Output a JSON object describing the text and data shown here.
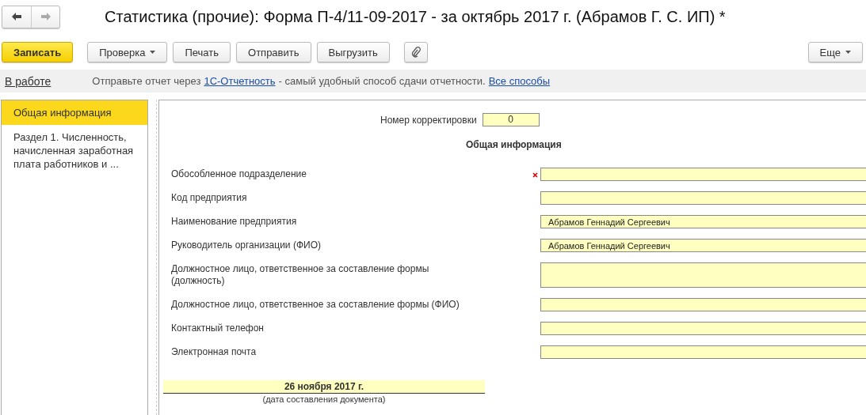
{
  "window": {
    "title": "Статистика (прочие): Форма П-4/11-09-2017 - за октябрь 2017 г. (Абрамов Г. С. ИП) *",
    "nav": [
      {
        "kind": "back",
        "disabled": false
      },
      {
        "kind": "forward",
        "disabled": true
      }
    ]
  },
  "toolbar": {
    "buttons": [
      {
        "kind": "primary",
        "label": "Записать"
      },
      {
        "kind": "dropdown",
        "label": "Проверка"
      },
      {
        "kind": "plain",
        "label": "Печать"
      },
      {
        "kind": "plain",
        "label": "Отправить"
      },
      {
        "kind": "plain",
        "label": "Выгрузить"
      },
      {
        "kind": "attach"
      }
    ],
    "more": {
      "label": "Еще"
    }
  },
  "info_bar": {
    "status": "В работе",
    "message": [
      {
        "kind": "text",
        "text": "Отправьте отчет через"
      },
      {
        "kind": "link",
        "text": "1С-Отчетность"
      },
      {
        "kind": "text",
        "text": "- самый удобный способ сдачи отчетности."
      },
      {
        "kind": "link",
        "text": "Все способы"
      }
    ]
  },
  "sidebar": {
    "items": [
      {
        "label": "Общая информация",
        "selected": true
      },
      {
        "label": "Раздел 1. Численность, начисленная заработная плата работников и ...",
        "selected": false
      }
    ]
  },
  "form": {
    "correction": {
      "label": "Номер корректировки",
      "value": "0"
    },
    "heading": "Общая информация",
    "fields": [
      {
        "label": "Обособленное подразделение",
        "required": true,
        "multiline": false
      },
      {
        "label": "Код предприятия",
        "required": false,
        "multiline": false
      },
      {
        "label": "Наименование предприятия",
        "value": "Абрамов Геннадий Сергеевич",
        "required": false,
        "multiline": false
      },
      {
        "label": "Руководитель организации (ФИО)",
        "value": "Абрамов Геннадий Сергеевич",
        "required": false,
        "multiline": false
      },
      {
        "label": "Должностное лицо, ответственное за составление формы (должность)",
        "required": false,
        "multiline": true
      },
      {
        "label": "Должностное лицо, ответственное за составление формы (ФИО)",
        "required": false,
        "multiline": false
      },
      {
        "label": "Контактный телефон",
        "required": false,
        "multiline": false
      },
      {
        "label": "Электронная почта",
        "required": false,
        "multiline": false
      }
    ],
    "date": {
      "value": "26 ноября 2017 г.",
      "caption": "(дата составления документа)"
    }
  }
}
